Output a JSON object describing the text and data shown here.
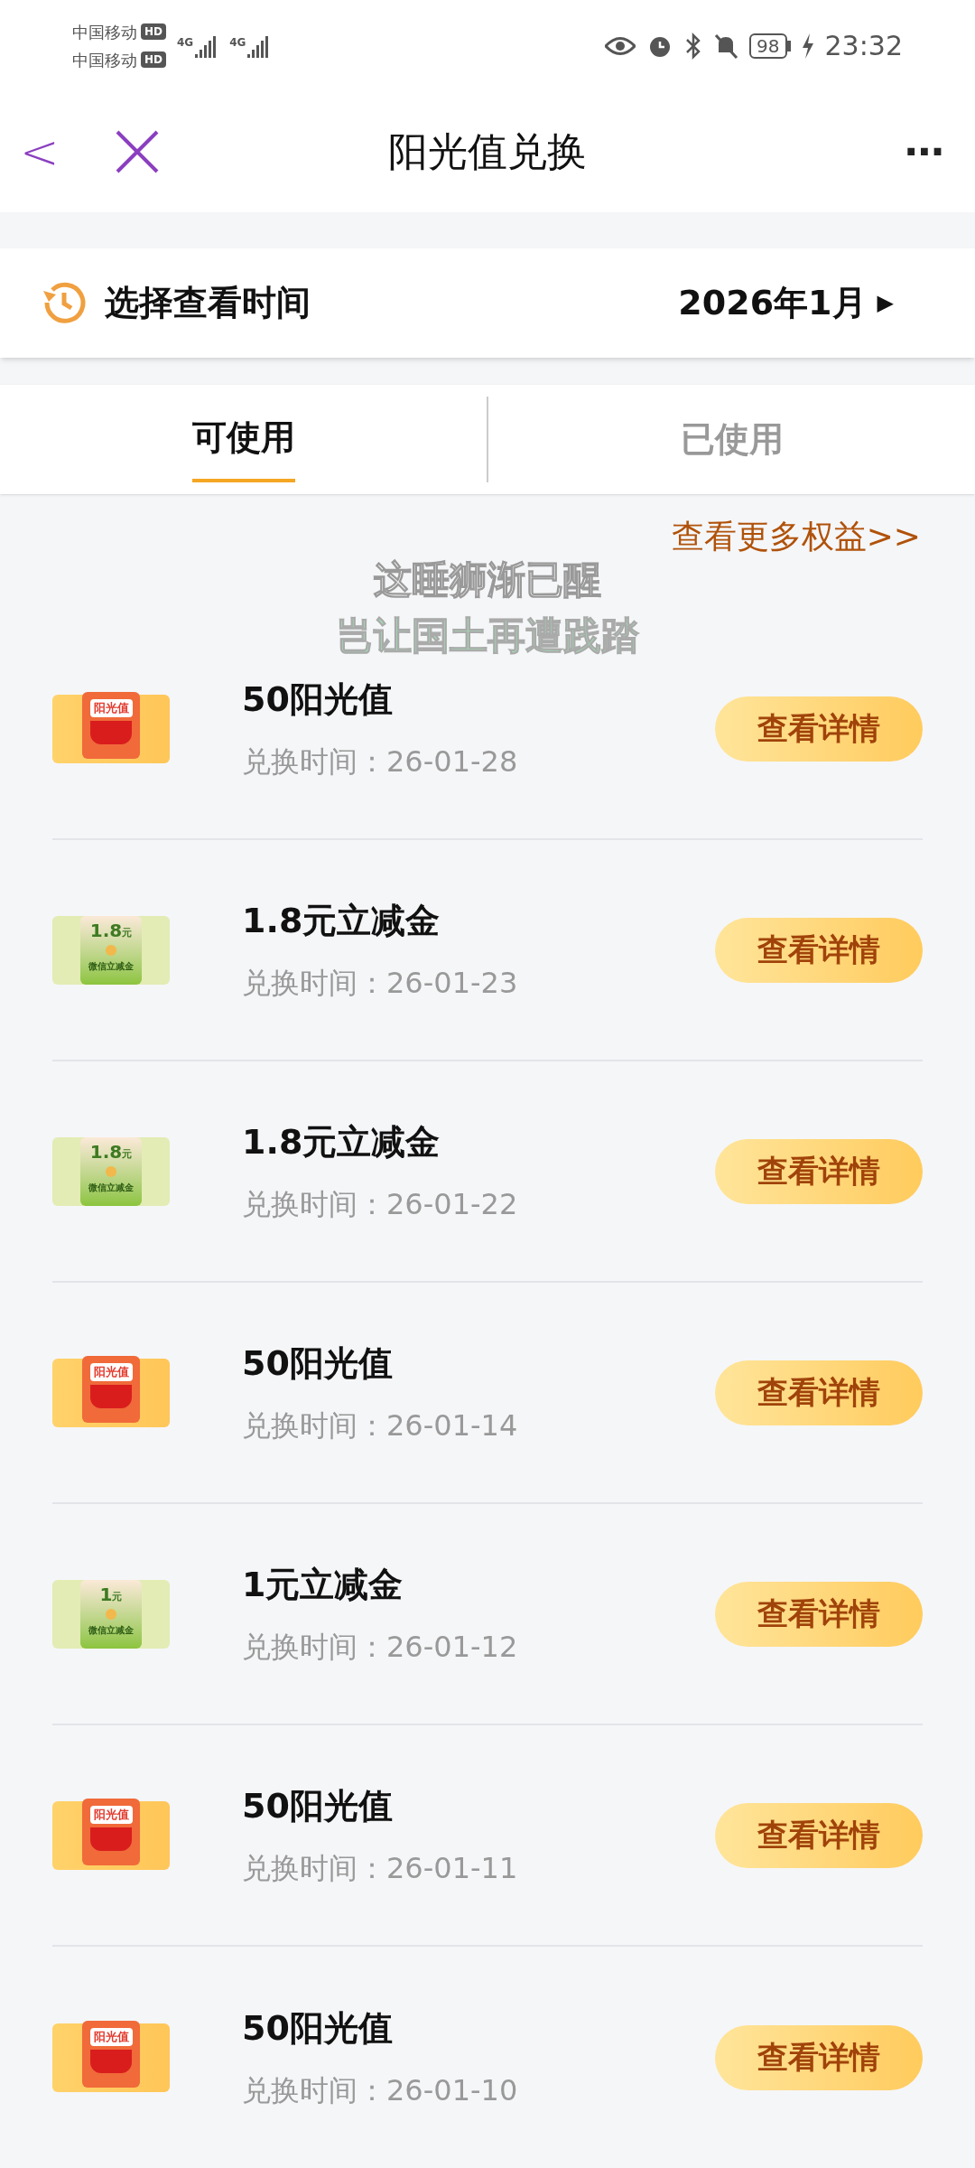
{
  "status_bar": {
    "carriers": [
      "中国移动",
      "中国移动"
    ],
    "hd": [
      "HD",
      "HD"
    ],
    "network": [
      "4G",
      "4G"
    ],
    "battery": "98",
    "time": "23:32"
  },
  "header": {
    "back": "<",
    "title": "阳光值兑换",
    "more": "⋯"
  },
  "time_picker": {
    "label": "选择查看时间",
    "value": "2026年1月",
    "arrow": "▶"
  },
  "tabs": [
    {
      "label": "可使用",
      "selected": true
    },
    {
      "label": "已使用",
      "selected": false
    }
  ],
  "more_link": "查看更多权益>>",
  "overlay_text": [
    "这睡狮渐已醒",
    "岂让国土再遭践踏"
  ],
  "items": [
    {
      "kind": "sunshine",
      "thumb_text": [
        "阳光值"
      ],
      "title": "50阳光值",
      "time_label": "兑换时间：",
      "time": "26-01-28",
      "button": "查看详情"
    },
    {
      "kind": "voucher",
      "thumb_text": [
        "1.8",
        "元",
        "微信立减金"
      ],
      "title": "1.8元立减金",
      "time_label": "兑换时间：",
      "time": "26-01-23",
      "button": "查看详情"
    },
    {
      "kind": "voucher",
      "thumb_text": [
        "1.8",
        "元",
        "微信立减金"
      ],
      "title": "1.8元立减金",
      "time_label": "兑换时间：",
      "time": "26-01-22",
      "button": "查看详情"
    },
    {
      "kind": "sunshine",
      "thumb_text": [
        "阳光值"
      ],
      "title": "50阳光值",
      "time_label": "兑换时间：",
      "time": "26-01-14",
      "button": "查看详情"
    },
    {
      "kind": "voucher",
      "thumb_text": [
        "1",
        "元",
        "微信立减金"
      ],
      "title": "1元立减金",
      "time_label": "兑换时间：",
      "time": "26-01-12",
      "button": "查看详情"
    },
    {
      "kind": "sunshine",
      "thumb_text": [
        "阳光值"
      ],
      "title": "50阳光值",
      "time_label": "兑换时间：",
      "time": "26-01-11",
      "button": "查看详情"
    },
    {
      "kind": "sunshine",
      "thumb_text": [
        "阳光值"
      ],
      "title": "50阳光值",
      "time_label": "兑换时间：",
      "time": "26-01-10",
      "button": "查看详情"
    }
  ]
}
